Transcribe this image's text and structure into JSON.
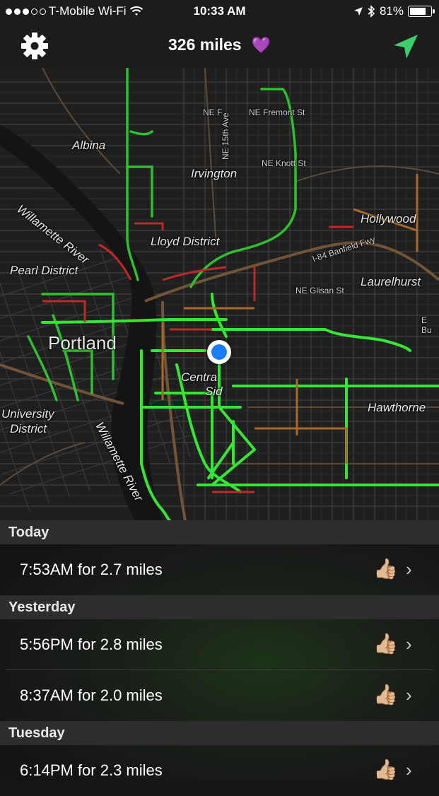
{
  "status_bar": {
    "carrier": "T-Mobile Wi-Fi",
    "time": "10:33 AM",
    "battery": "81%",
    "battery_level": 0.81,
    "signal_dots_filled": 3,
    "signal_dots_total": 5
  },
  "header": {
    "title": "326 miles",
    "heart_emoji": "💜",
    "settings_icon": "gear-icon",
    "locate_icon": "location-arrow-icon",
    "accent_color": "#3ecf6b"
  },
  "map": {
    "labels": {
      "albina": "Albina",
      "irvington": "Irvington",
      "willamette_river_top": "Willamette River",
      "lloyd_district": "Lloyd District",
      "pearl_district": "Pearl District",
      "hollywood": "Hollywood",
      "laurelhurst": "Laurelhurst",
      "portland": "Portland",
      "central": "Centra",
      "central2": "Sid",
      "university": "University",
      "district": "District",
      "willamette_river_bottom": "Willamette River",
      "hawthorne": "Hawthorne",
      "ne_f": "NE F",
      "ne_fremont": "NE Fremont St",
      "ne_15th": "NE 15th Ave",
      "ne_knott": "NE Knott St",
      "ne_glisan": "NE Glisan St",
      "e_bu": "E Bu",
      "banfield": "I-84 Banfield Fwy"
    }
  },
  "trips": {
    "sections": [
      {
        "title": "Today",
        "rows": [
          {
            "label": "7:53AM for 2.7 miles",
            "rating": "👍🏼"
          }
        ]
      },
      {
        "title": "Yesterday",
        "rows": [
          {
            "label": "5:56PM for 2.8 miles",
            "rating": "👍🏼"
          },
          {
            "label": "8:37AM for 2.0 miles",
            "rating": "👍🏼"
          }
        ]
      },
      {
        "title": "Tuesday",
        "rows": [
          {
            "label": "6:14PM for 2.3 miles",
            "rating": "👍🏼"
          }
        ]
      }
    ]
  }
}
